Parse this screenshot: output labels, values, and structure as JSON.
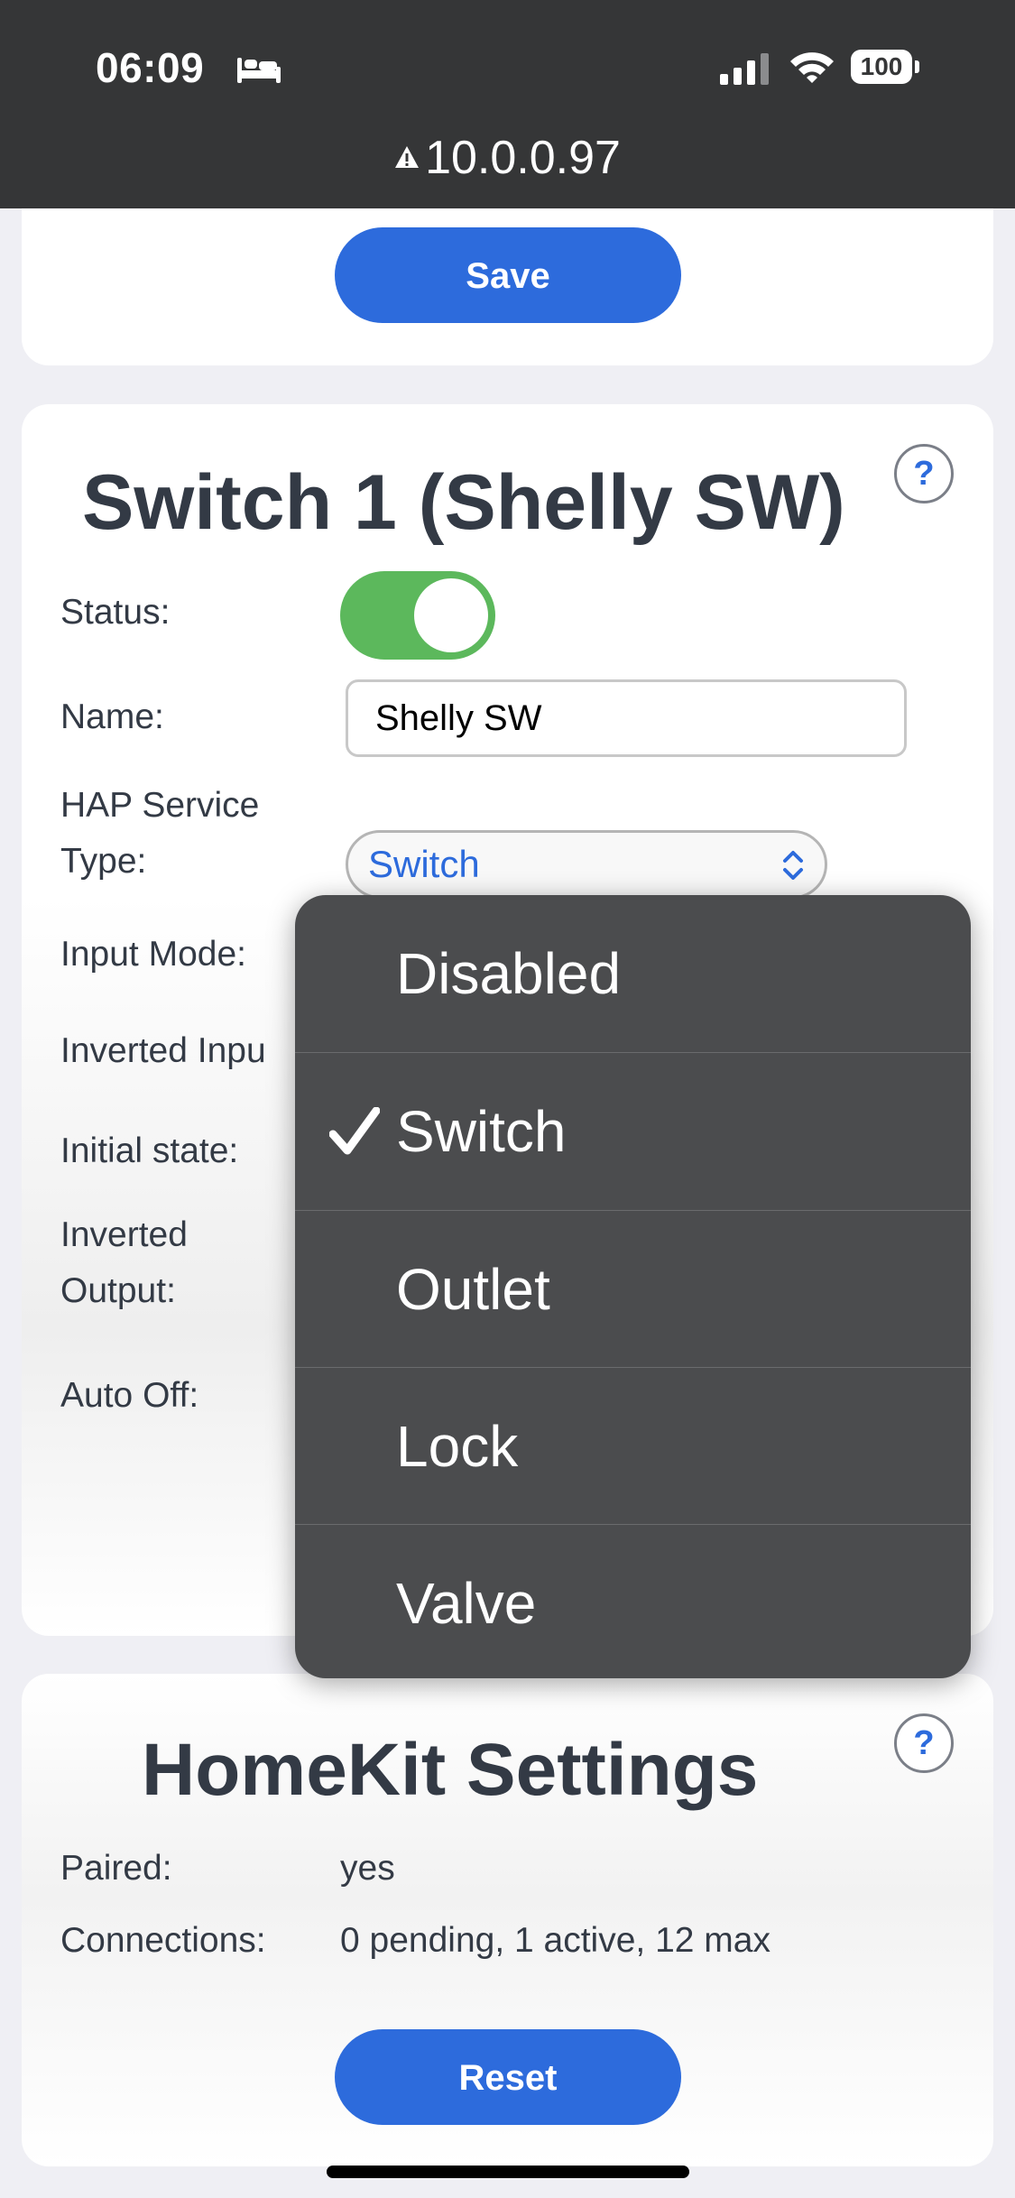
{
  "status_bar": {
    "time": "06:09",
    "sleep_icon": "bed-icon",
    "battery": "100"
  },
  "url_bar": {
    "address": "10.0.0.97",
    "warning_icon": "warning-triangle-icon"
  },
  "top_card": {
    "save_label": "Save"
  },
  "switch_card": {
    "title": "Switch 1 (Shelly SW)",
    "help_label": "?",
    "fields": {
      "status_label": "Status:",
      "status_on": true,
      "name_label": "Name:",
      "name_value": "Shelly SW",
      "hap_label_line1": "HAP Service",
      "hap_label_line2": "Type:",
      "hap_value": "Switch",
      "input_mode_label": "Input Mode:",
      "inverted_input_label": "Inverted Inpu",
      "initial_state_label": "Initial state:",
      "inverted_output_line1": "Inverted",
      "inverted_output_line2": "Output:",
      "auto_off_label": "Auto Off:"
    }
  },
  "dropdown": {
    "options": [
      "Disabled",
      "Switch",
      "Outlet",
      "Lock",
      "Valve"
    ],
    "selected": "Switch"
  },
  "homekit_card": {
    "title": "HomeKit Settings",
    "help_label": "?",
    "paired_label": "Paired:",
    "paired_value": "yes",
    "connections_label": "Connections:",
    "connections_value": "0 pending, 1 active, 12 max",
    "reset_label": "Reset"
  },
  "colors": {
    "accent": "#2d6bdc",
    "toggle_on": "#5cb85c",
    "top_bar": "#353637",
    "dropdown_bg": "#4b4c4e"
  }
}
